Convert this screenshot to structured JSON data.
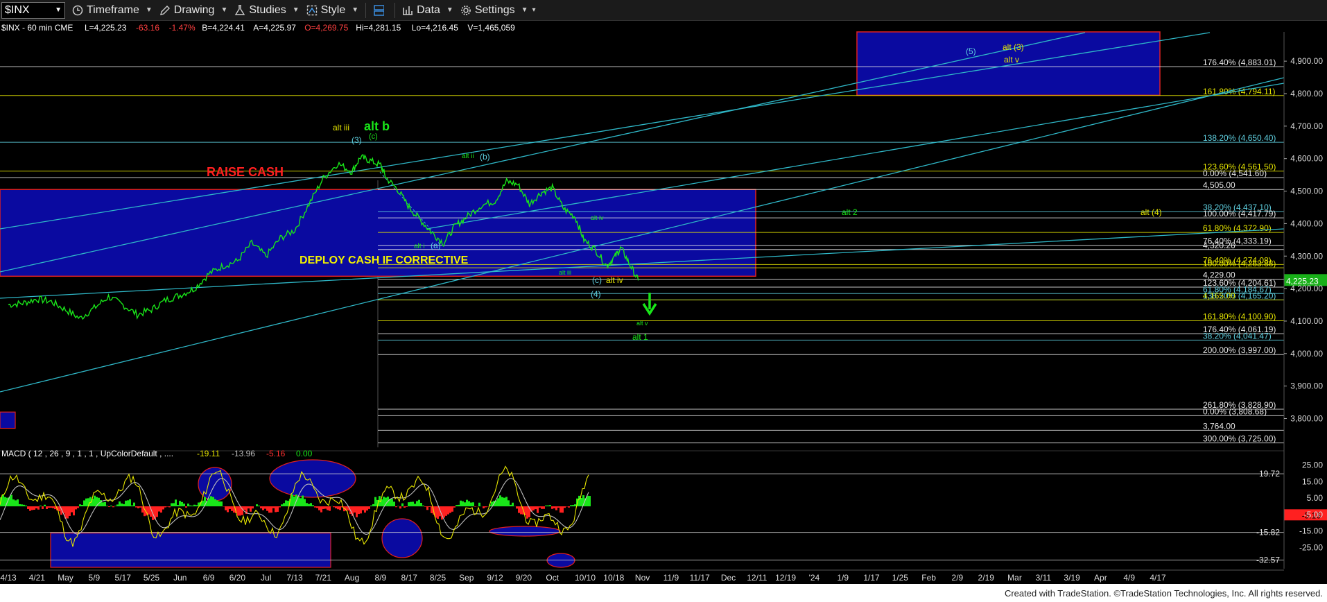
{
  "toolbar": {
    "symbol": "$INX",
    "items": [
      {
        "label": "Timeframe",
        "icon": "clock-icon"
      },
      {
        "label": "Drawing",
        "icon": "pencil-icon"
      },
      {
        "label": "Studies",
        "icon": "flask-icon"
      },
      {
        "label": "Style",
        "icon": "style-icon"
      },
      {
        "label": "",
        "icon": "layout-icon"
      },
      {
        "label": "Data",
        "icon": "bar-chart-icon"
      },
      {
        "label": "Settings",
        "icon": "gear-icon"
      }
    ]
  },
  "info_bar": {
    "prefix": "$INX - 60 min  CME",
    "fields": [
      {
        "text": "L=4,225.23",
        "color": "#ffffff"
      },
      {
        "text": "-63.16",
        "color": "#ff4040"
      },
      {
        "text": "-1.47%",
        "color": "#ff4040"
      },
      {
        "text": "B=4,224.41",
        "color": "#ffffff"
      },
      {
        "text": "A=4,225.97",
        "color": "#ffffff"
      },
      {
        "text": "O=4,269.75",
        "color": "#ff4040"
      },
      {
        "text": "Hi=4,281.15",
        "color": "#ffffff"
      },
      {
        "text": "Lo=4,216.45",
        "color": "#ffffff"
      },
      {
        "text": "V=1,465,059",
        "color": "#ffffff"
      }
    ]
  },
  "colors": {
    "price": "#19e619",
    "channel": "#2fb8c8",
    "zone_fill": "#0a0aa0",
    "zone_border": "#e02020",
    "fib_yellow": "#e6e600",
    "fib_cyan": "#5fd0e0",
    "fib_white": "#e8e8e8",
    "macd_line": "#e6e600",
    "signal_line": "#bfbfbf",
    "hist_pos": "#19e619",
    "hist_neg": "#ff2020",
    "last_price_bg": "#19b019"
  },
  "chart_data": [
    {
      "type": "line",
      "series_name": "$INX - 60 min",
      "y_axis": {
        "ticks": [
          3800,
          3900,
          4000,
          4100,
          4200,
          4300,
          4400,
          4500,
          4600,
          4700,
          4800,
          4900
        ],
        "tick_labels": [
          "3,800.00",
          "3,900.00",
          "4,000.00",
          "4,100.00",
          "4,200.00",
          "4,300.00",
          "4,400.00",
          "4,500.00",
          "4,600.00",
          "4,700.00",
          "4,800.00",
          "4,900.00"
        ],
        "range": [
          3705,
          4990
        ]
      },
      "x_axis": {
        "tick_labels": [
          "4/13",
          "4/21",
          "May",
          "5/9",
          "5/17",
          "5/25",
          "Jun",
          "6/9",
          "6/20",
          "Jul",
          "7/13",
          "7/21",
          "Aug",
          "8/9",
          "8/17",
          "8/25",
          "Sep",
          "9/12",
          "9/20",
          "Oct",
          "10/10",
          "10/18",
          "Nov",
          "11/9",
          "11/17",
          "Dec",
          "12/11",
          "12/19",
          "'24",
          "1/9",
          "1/17",
          "1/25",
          "Feb",
          "2/9",
          "2/19",
          "Mar",
          "3/11",
          "3/19",
          "Apr",
          "4/9",
          "4/17"
        ]
      },
      "price_path": [
        [
          0,
          4150
        ],
        [
          0.5,
          4155
        ],
        [
          1,
          4168
        ],
        [
          1.5,
          4160
        ],
        [
          2,
          4135
        ],
        [
          2.5,
          4108
        ],
        [
          3,
          4140
        ],
        [
          3.5,
          4175
        ],
        [
          4,
          4150
        ],
        [
          4.5,
          4120
        ],
        [
          5,
          4135
        ],
        [
          5.5,
          4165
        ],
        [
          6,
          4180
        ],
        [
          6.5,
          4200
        ],
        [
          7,
          4245
        ],
        [
          7.5,
          4270
        ],
        [
          8,
          4285
        ],
        [
          8.5,
          4340
        ],
        [
          9,
          4300
        ],
        [
          9.5,
          4355
        ],
        [
          10,
          4380
        ],
        [
          10.5,
          4460
        ],
        [
          11,
          4540
        ],
        [
          11.5,
          4585
        ],
        [
          12,
          4560
        ],
        [
          12.3,
          4605
        ],
        [
          12.6,
          4595
        ],
        [
          13,
          4580
        ],
        [
          13.2,
          4540
        ],
        [
          13.6,
          4505
        ],
        [
          14,
          4450
        ],
        [
          14.4,
          4410
        ],
        [
          14.8,
          4372
        ],
        [
          15.2,
          4340
        ],
        [
          15.6,
          4392
        ],
        [
          16,
          4420
        ],
        [
          16.5,
          4455
        ],
        [
          17,
          4470
        ],
        [
          17.4,
          4530
        ],
        [
          17.8,
          4520
        ],
        [
          18.2,
          4460
        ],
        [
          18.6,
          4495
        ],
        [
          19,
          4510
        ],
        [
          19.4,
          4445
        ],
        [
          19.8,
          4420
        ],
        [
          20.1,
          4350
        ],
        [
          20.5,
          4320
        ],
        [
          20.9,
          4270
        ],
        [
          21.2,
          4300
        ],
        [
          21.4,
          4325
        ],
        [
          21.7,
          4275
        ],
        [
          22,
          4225
        ]
      ],
      "last_price": "4,225.23",
      "annotations": [
        "RAISE CASH",
        "DEPLOY CASH IF CORRECTIVE",
        "alt iii",
        "(3)",
        "(c)",
        "alt b",
        "alt ii",
        "(b)",
        "alt i",
        "(a)",
        "alt iv",
        "alt iii",
        "(c)",
        "alt iv",
        "(4)",
        "alt v",
        "alt 1",
        "alt 2",
        "(5)",
        "alt (3)",
        "alt v",
        "alt (4)"
      ],
      "fib_levels": [
        {
          "label": "176.40% (4,883.01)",
          "value": 4883.01,
          "color": "white"
        },
        {
          "label": "161.80% (4,794.11)",
          "value": 4794.11,
          "color": "yellow"
        },
        {
          "label": "138.20% (4,650.40)",
          "value": 4650.4,
          "color": "cyan"
        },
        {
          "label": "123.60% (4,561.50)",
          "value": 4561.5,
          "color": "yellow"
        },
        {
          "label": "0.00% (4,541.60)",
          "value": 4541.6,
          "color": "white"
        },
        {
          "label": "4,505.00",
          "value": 4505.0,
          "color": "white"
        },
        {
          "label": "38.20% (4,437.10)",
          "value": 4437.1,
          "color": "cyan"
        },
        {
          "label": "100.00% (4,417.79)",
          "value": 4417.79,
          "color": "white"
        },
        {
          "label": "61.80% (4,372.90)",
          "value": 4372.9,
          "color": "yellow"
        },
        {
          "label": "76.40% (4,333.19)",
          "value": 4333.19,
          "color": "white"
        },
        {
          "label": "4,320.26",
          "value": 4320.26,
          "color": "white"
        },
        {
          "label": "76.40% (4,274.08)",
          "value": 4274.08,
          "color": "yellow"
        },
        {
          "label": "100.00% (4,263.88)",
          "value": 4263.88,
          "color": "yellow"
        },
        {
          "label": "4,229.00",
          "value": 4229.0,
          "color": "white"
        },
        {
          "label": "123.60% (4,204.61)",
          "value": 4204.61,
          "color": "white"
        },
        {
          "label": "61.80% (4,184.67)",
          "value": 4184.67,
          "color": "cyan"
        },
        {
          "label": "138.20% (4,165.20)",
          "value": 4165.2,
          "color": "cyan"
        },
        {
          "label": "4,165.00",
          "value": 4165.0,
          "color": "yellow"
        },
        {
          "label": "161.80% (4,100.90)",
          "value": 4100.9,
          "color": "yellow"
        },
        {
          "label": "176.40% (4,061.19)",
          "value": 4061.19,
          "color": "white"
        },
        {
          "label": "38.20% (4,041.47)",
          "value": 4041.47,
          "color": "cyan"
        },
        {
          "label": "200.00% (3,997.00)",
          "value": 3997.0,
          "color": "white"
        },
        {
          "label": "261.80% (3,828.90)",
          "value": 3828.9,
          "color": "white"
        },
        {
          "label": "0.00% (3,808.68)",
          "value": 3808.68,
          "color": "white"
        },
        {
          "label": "3,764.00",
          "value": 3764.0,
          "color": "white"
        },
        {
          "label": "300.00% (3,725.00)",
          "value": 3725.0,
          "color": "white"
        }
      ]
    },
    {
      "type": "line",
      "title": "MACD ( 12 , 26 , 9 , 1 , 1 , UpColorDefault , ....",
      "legend_values": [
        {
          "text": "-19.11",
          "color": "#e6e600"
        },
        {
          "text": "-13.96",
          "color": "#bfbfbf"
        },
        {
          "text": "-5.16",
          "color": "#ff3030"
        },
        {
          "text": "0.00",
          "color": "#19e619"
        }
      ],
      "y_axis": {
        "ticks": [
          25,
          15,
          5,
          -5,
          -15,
          -25
        ],
        "tick_labels": [
          "25.00",
          "15.00",
          "5.00",
          "-5.00",
          "-15.00",
          "-25.00"
        ],
        "range": [
          -37,
          32
        ]
      },
      "markers": [
        {
          "label": "19.72",
          "value": 19.72
        },
        {
          "label": "-15.82",
          "value": -15.82
        },
        {
          "label": "-32.57",
          "value": -32.57
        }
      ],
      "last_value": "-5.16"
    }
  ],
  "footer": "Created with TradeStation. ©TradeStation Technologies, Inc. All rights reserved."
}
